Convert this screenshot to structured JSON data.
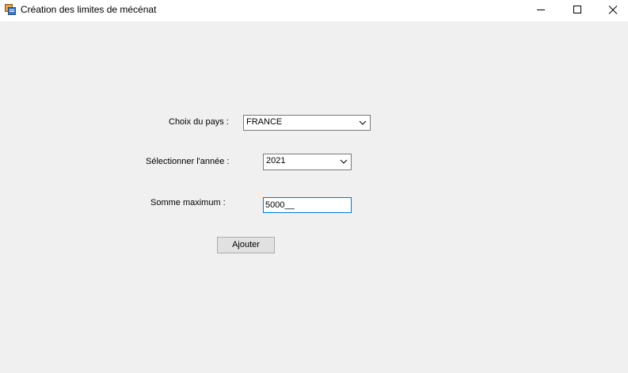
{
  "window": {
    "title": "Création des limites de mécénat"
  },
  "form": {
    "country_label": "Choix du pays :",
    "country_value": "FRANCE",
    "year_label": "Sélectionner l'année :",
    "year_value": "2021",
    "amount_label": "Somme maximum :",
    "amount_value": "5000__",
    "add_button_label": "Ajouter"
  },
  "colors": {
    "background": "#f0f0f0",
    "focus_border": "#0078d7"
  },
  "icons": {
    "app": "app-form-icon",
    "minimize": "minimize-icon",
    "maximize": "maximize-icon",
    "close": "close-icon",
    "dropdown": "chevron-down-icon"
  }
}
